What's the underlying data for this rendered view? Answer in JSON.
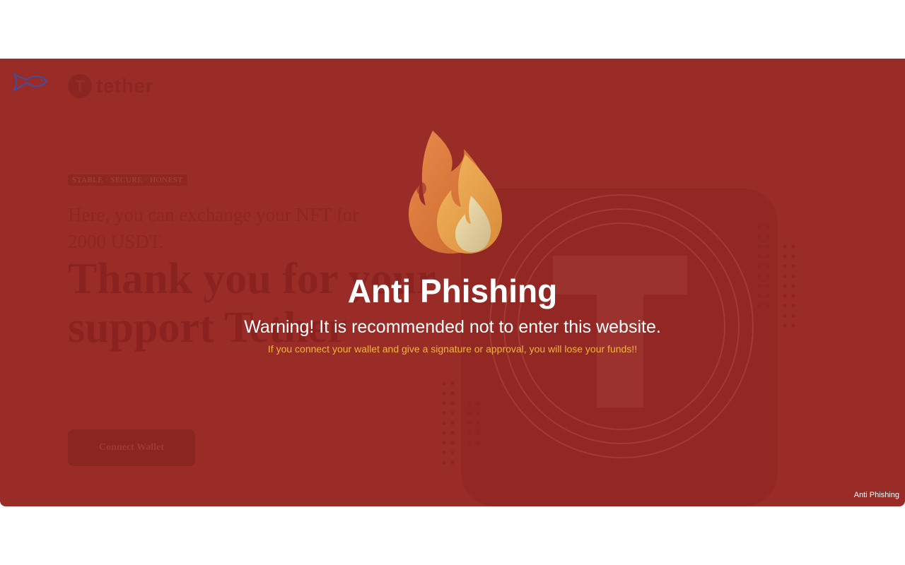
{
  "site": {
    "logo_symbol": "T",
    "logo_text": "tether",
    "badge": "STABLE · SECURE · HONEST",
    "subline": "Here, you can exchange your NFT for 2000 USDT.",
    "headline": "Thank you for your support Tether",
    "connect_button": "Connect Wallet"
  },
  "overlay": {
    "title": "Anti Phishing",
    "warning": "Warning! It is recommended not to enter this website.",
    "detail": "If you connect your wallet and give a signature or approval, you will lose your funds!!",
    "corner_label": "Anti Phishing",
    "icon": "fire-icon"
  },
  "icons": {
    "top_left": "fish-icon"
  },
  "colors": {
    "overlay": "#9a2c28",
    "title": "#ffffff",
    "detail": "#f5b33d"
  }
}
